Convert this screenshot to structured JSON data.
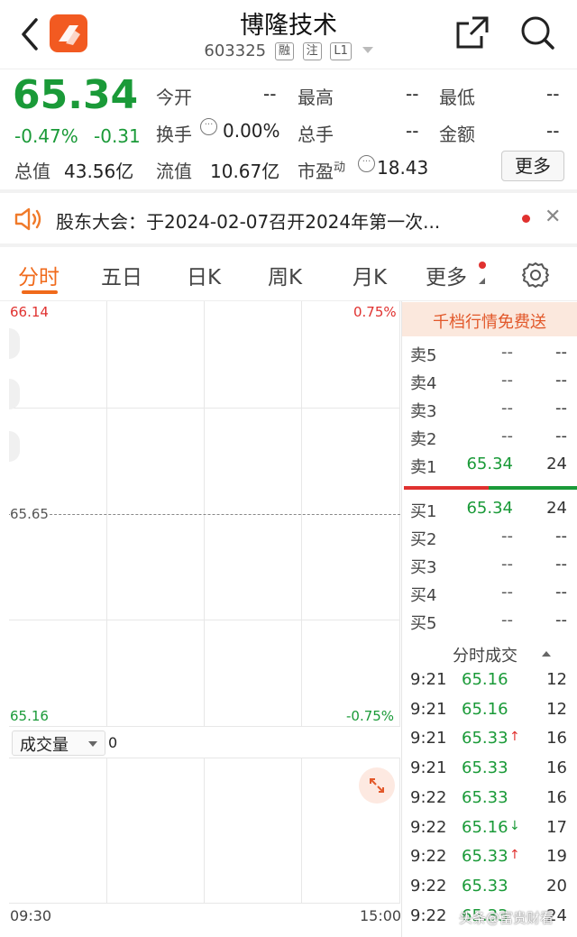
{
  "header": {
    "title": "博隆技术",
    "code": "603325",
    "tags": [
      "融",
      "注",
      "L1"
    ]
  },
  "quote": {
    "price": "65.34",
    "change_pct": "-0.47%",
    "change": "-0.31",
    "open_label": "今开",
    "open_value": "--",
    "high_label": "最高",
    "high_value": "--",
    "low_label": "最低",
    "low_value": "--",
    "turnover_label": "换手",
    "turnover_value": "0.00%",
    "volume_label": "总手",
    "volume_value": "--",
    "amount_label": "金额",
    "amount_value": "--",
    "mcap_label": "总值",
    "mcap_value": "43.56亿",
    "float_label": "流值",
    "float_value": "10.67亿",
    "pe_label": "市盈",
    "pe_sup": "动",
    "pe_value": "18.43",
    "more_button": "更多"
  },
  "notice": {
    "text": "股东大会：于2024-02-07召开2024年第一次..."
  },
  "tabs": [
    "分时",
    "五日",
    "日K",
    "周K",
    "月K",
    "更多"
  ],
  "chart": {
    "y_top": "66.14",
    "pct_top": "0.75%",
    "y_mid": "65.65",
    "y_bottom": "65.16",
    "pct_bottom": "-0.75%",
    "volume_label": "成交量",
    "volume_value": "0",
    "time_start": "09:30",
    "time_end": "15:00"
  },
  "orderbook": {
    "banner": "千档行情免费送",
    "sells": [
      {
        "label": "卖5",
        "price": "--",
        "vol": "--"
      },
      {
        "label": "卖4",
        "price": "--",
        "vol": "--"
      },
      {
        "label": "卖3",
        "price": "--",
        "vol": "--"
      },
      {
        "label": "卖2",
        "price": "--",
        "vol": "--"
      },
      {
        "label": "卖1",
        "price": "65.34",
        "vol": "24"
      }
    ],
    "buys": [
      {
        "label": "买1",
        "price": "65.34",
        "vol": "24"
      },
      {
        "label": "买2",
        "price": "--",
        "vol": "--"
      },
      {
        "label": "买3",
        "price": "--",
        "vol": "--"
      },
      {
        "label": "买4",
        "price": "--",
        "vol": "--"
      },
      {
        "label": "买5",
        "price": "--",
        "vol": "--"
      }
    ],
    "trades_title": "分时成交",
    "trades": [
      {
        "time": "9:21",
        "price": "65.16",
        "arrow": "",
        "vol": "12"
      },
      {
        "time": "9:21",
        "price": "65.16",
        "arrow": "",
        "vol": "12"
      },
      {
        "time": "9:21",
        "price": "65.33",
        "arrow": "↑",
        "vol": "16"
      },
      {
        "time": "9:21",
        "price": "65.33",
        "arrow": "",
        "vol": "16"
      },
      {
        "time": "9:22",
        "price": "65.33",
        "arrow": "",
        "vol": "16"
      },
      {
        "time": "9:22",
        "price": "65.16",
        "arrow": "↓",
        "vol": "17"
      },
      {
        "time": "9:22",
        "price": "65.33",
        "arrow": "↑",
        "vol": "19"
      },
      {
        "time": "9:22",
        "price": "65.33",
        "arrow": "",
        "vol": "20"
      },
      {
        "time": "9:22",
        "price": "65.33",
        "arrow": "",
        "vol": "24"
      }
    ]
  },
  "watermark": "头条@富贵财看"
}
